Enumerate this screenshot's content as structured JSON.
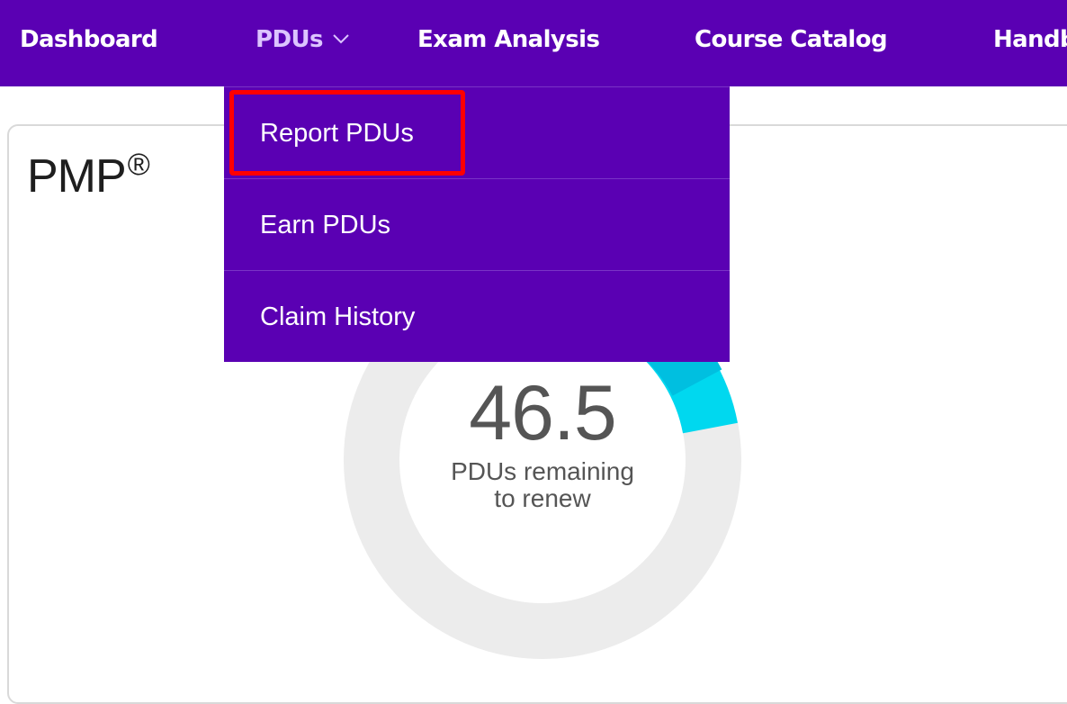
{
  "nav": {
    "items": [
      {
        "label": "Dashboard"
      },
      {
        "label": "PDUs"
      },
      {
        "label": "Exam Analysis"
      },
      {
        "label": "Course Catalog"
      },
      {
        "label": "Handbook"
      }
    ],
    "pdus_icon": "chevron-down-icon"
  },
  "card": {
    "title": "PMP",
    "title_mark": "®",
    "progress": {
      "value": "46.5",
      "caption_line1": "PDUs remaining",
      "caption_line2": "to renew"
    }
  },
  "dropdown": {
    "items": [
      {
        "label": "Report PDUs",
        "highlighted": true
      },
      {
        "label": "Earn PDUs"
      },
      {
        "label": "Claim History"
      }
    ]
  },
  "colors": {
    "nav_background": "#5a00b3",
    "active_nav_text": "#dcc4ff",
    "donut_track": "#ececec",
    "donut_earned": "#00c8e6",
    "highlight": "#ff0000"
  }
}
